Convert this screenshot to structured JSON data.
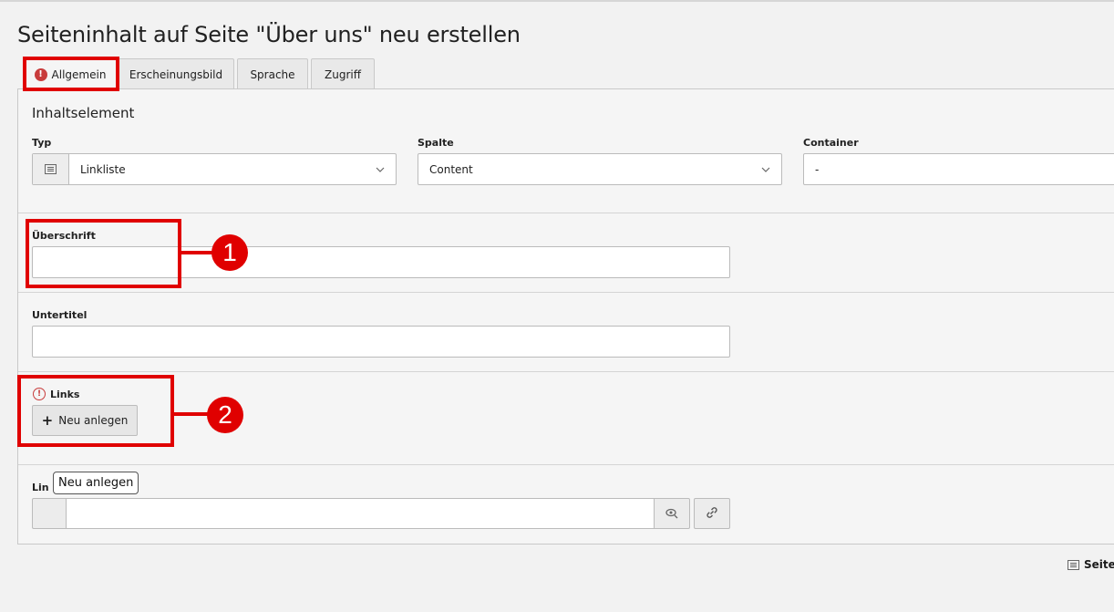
{
  "title": "Seiteninhalt auf Seite \"Über uns\" neu erstellen",
  "tabs": [
    {
      "label": "Allgemein",
      "has_error": true
    },
    {
      "label": "Erscheinungsbild"
    },
    {
      "label": "Sprache"
    },
    {
      "label": "Zugriff"
    }
  ],
  "section": {
    "title": "Inhaltselement"
  },
  "fields": {
    "typ": {
      "label": "Typ",
      "value": "Linkliste",
      "icon": "list-icon"
    },
    "spalte": {
      "label": "Spalte",
      "value": "Content"
    },
    "container": {
      "label": "Container",
      "value": "-"
    },
    "ueberschrift": {
      "label": "Überschrift",
      "value": ""
    },
    "untertitel": {
      "label": "Untertitel",
      "value": ""
    },
    "links": {
      "label": "Links",
      "button": "Neu anlegen"
    },
    "link": {
      "label_partial": "Lin",
      "value": ""
    }
  },
  "tooltip": {
    "text": "Neu anlegen"
  },
  "footer": {
    "label": "Seite",
    "icon": "list-icon"
  },
  "annotations": [
    {
      "number": "1",
      "target": "Überschrift"
    },
    {
      "number": "2",
      "target": "Links"
    }
  ],
  "colors": {
    "error": "#c83c3c",
    "annotation": "#e00000"
  }
}
